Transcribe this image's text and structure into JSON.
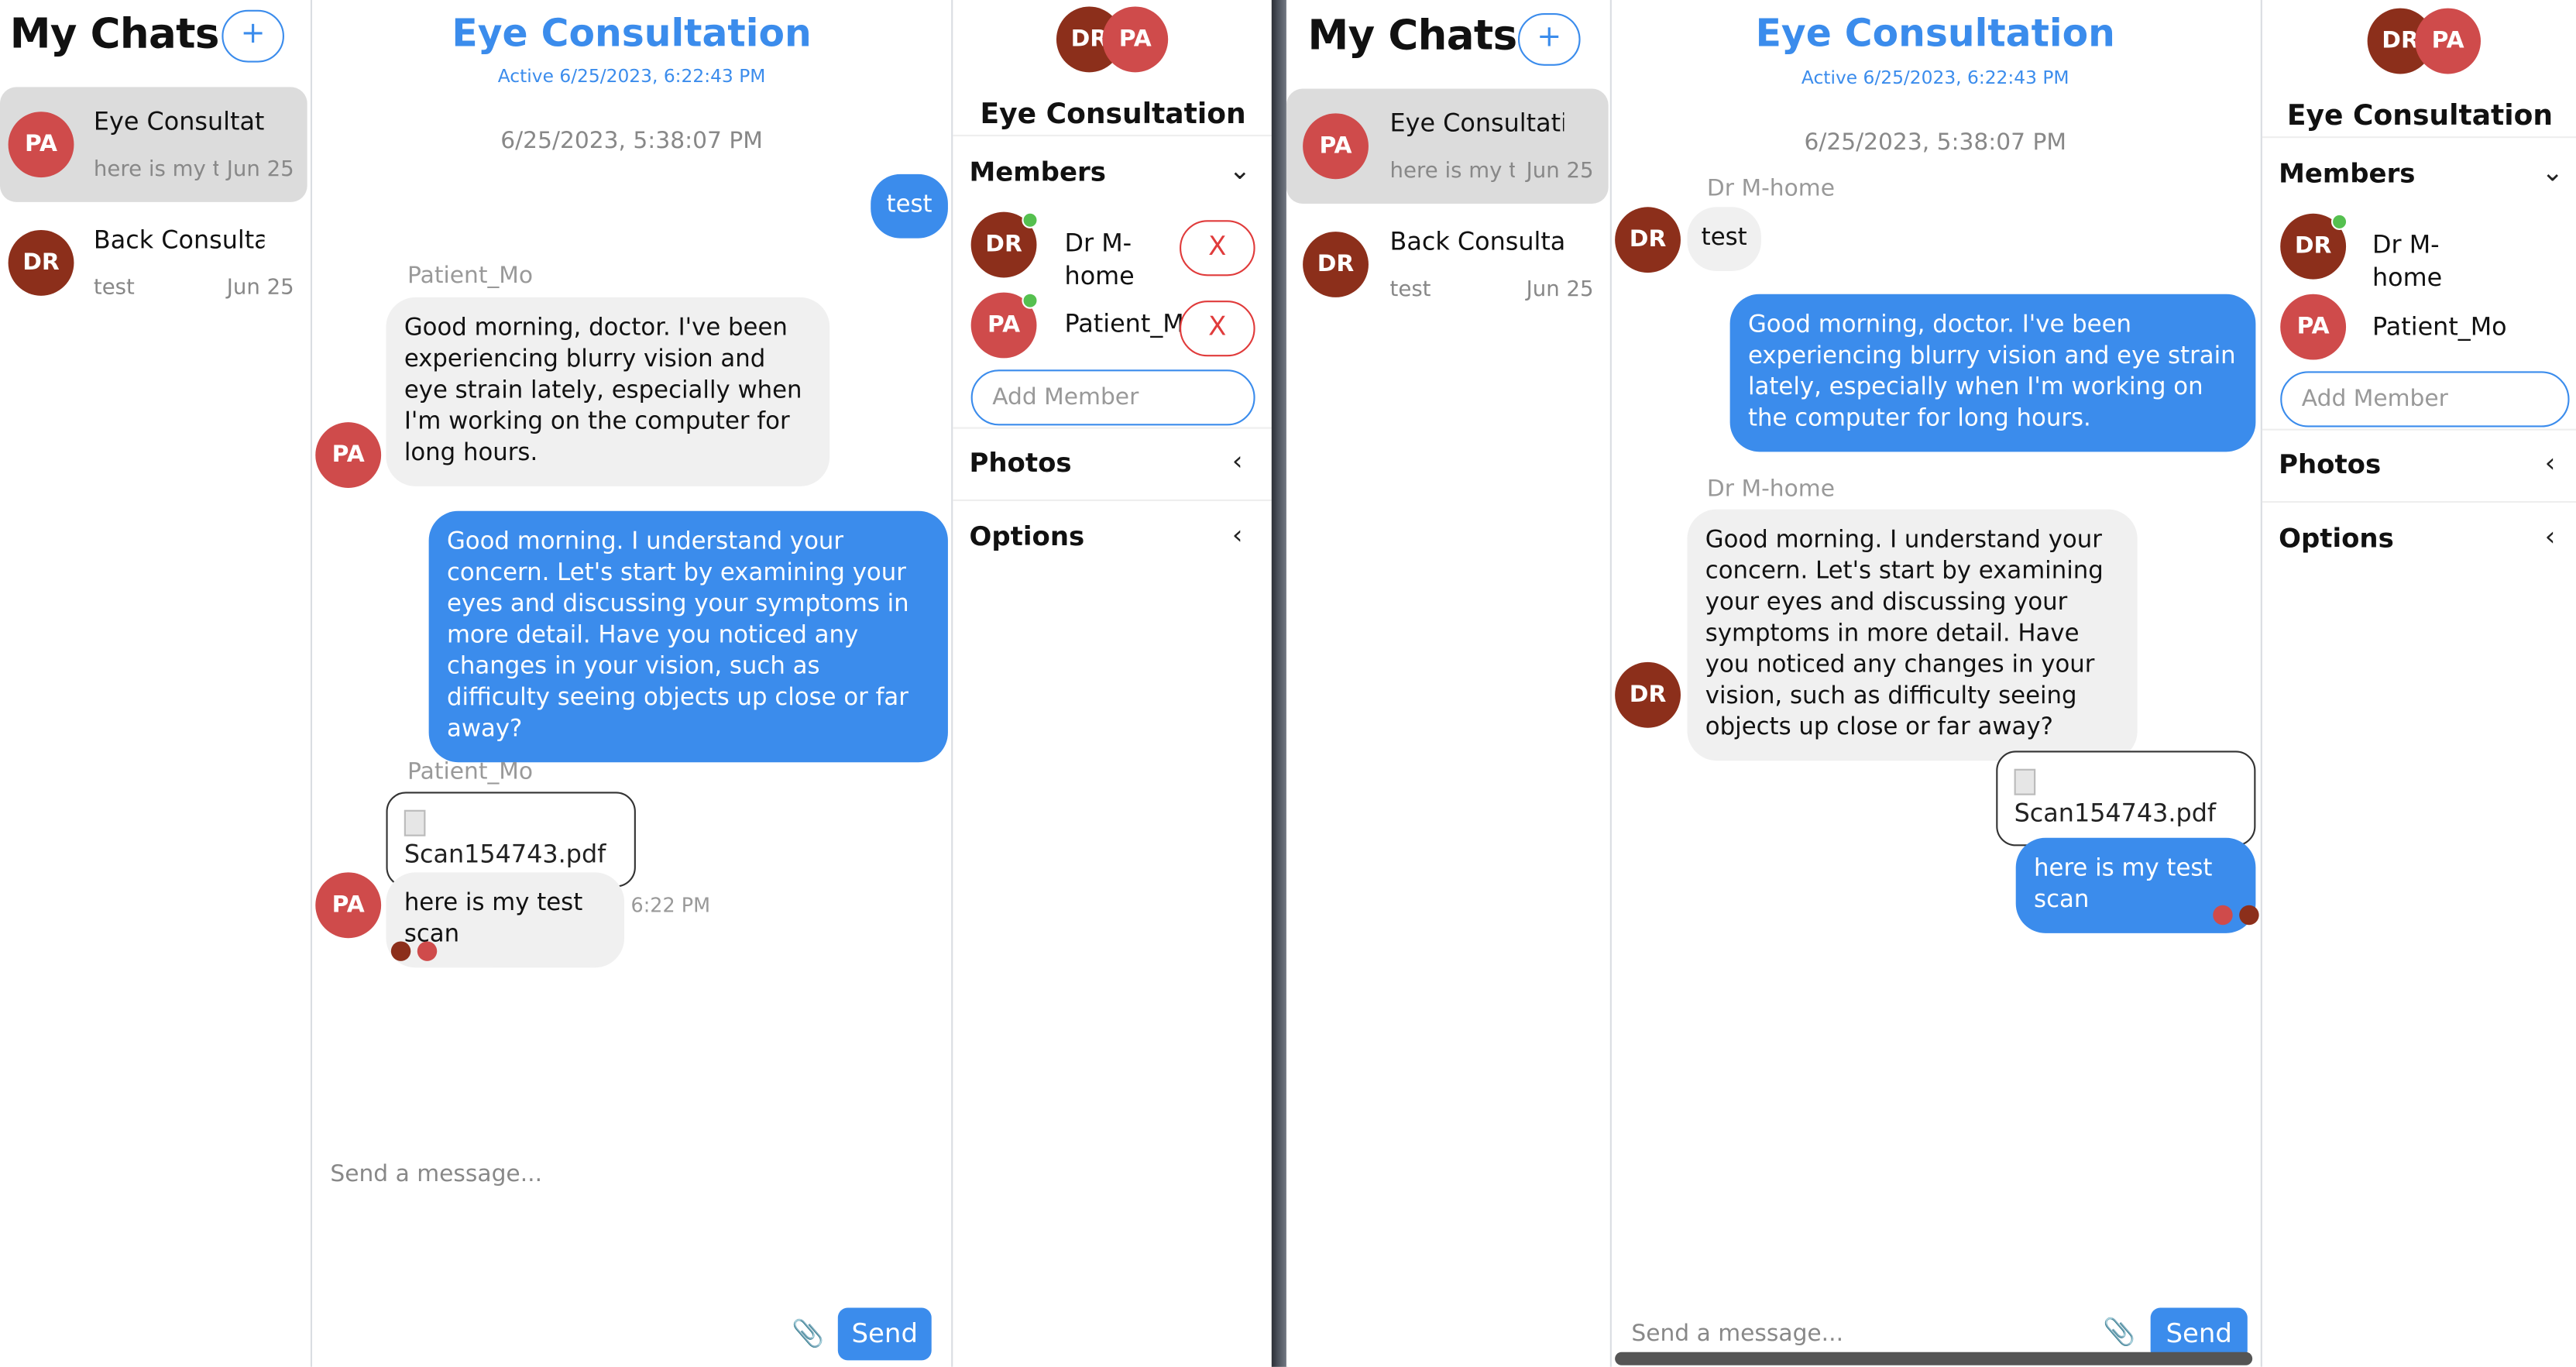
{
  "sidebar": {
    "title": "My Chats",
    "new_chat_glyph": "+",
    "chats": [
      {
        "initials": "PA",
        "title": "Eye Consultati",
        "preview": "here is my te",
        "date": "Jun 25"
      },
      {
        "initials": "DR",
        "title": "Back Consultat",
        "preview": "test",
        "date": "Jun 25"
      }
    ]
  },
  "feed": {
    "title": "Eye Consultation",
    "active_status": "Active 6/25/2023, 6:22:43 PM",
    "timestamp": "6/25/2023, 5:38:07 PM",
    "composer_placeholder": "Send a message...",
    "send_label": "Send",
    "file_name": "Scan154743.pdf",
    "left_view": {
      "messages": [
        {
          "sender": "",
          "text": "test"
        },
        {
          "sender": "Patient_Mo",
          "text": "Good morning, doctor. I've been experiencing blurry vision and eye strain lately, especially when I'm working on the computer for long hours."
        },
        {
          "sender": "",
          "text": "Good morning. I understand your concern. Let's start by examining your eyes and discussing your symptoms in more detail. Have you noticed any changes in your vision, such as difficulty seeing objects up close or far away?"
        },
        {
          "sender": "Patient_Mo",
          "text": "here is my test scan",
          "time": "6:22 PM"
        }
      ]
    },
    "right_view": {
      "messages": [
        {
          "sender": "Dr M-home",
          "text": "test"
        },
        {
          "sender": "",
          "text": "Good morning, doctor. I've been experiencing blurry vision and eye strain lately, especially when I'm working on the computer for long hours."
        },
        {
          "sender": "Dr M-home",
          "text": "Good morning. I understand your concern. Let's start by examining your eyes and discussing your symptoms in more detail. Have you noticed any changes in your vision, such as difficulty seeing objects up close or far away?"
        },
        {
          "sender": "",
          "text": "here is my test scan"
        }
      ]
    }
  },
  "settings": {
    "title": "Eye Consultation",
    "members_label": "Members",
    "photos_label": "Photos",
    "options_label": "Options",
    "add_member_placeholder": "Add Member",
    "remove_glyph": "X",
    "members": [
      {
        "initials": "DR",
        "name": "Dr M-home"
      },
      {
        "initials": "PA",
        "name": "Patient_Mo"
      }
    ],
    "left_member2_truncated": "Patient_M "
  },
  "icons": {
    "expand": "chevron-down-icon",
    "collapse": "chevron-left-icon",
    "attach": "paperclip-icon",
    "file": "document-icon"
  },
  "colors": {
    "accent": "#3b8cec",
    "avatar_patient": "#cf4b4b",
    "avatar_doctor": "#8c2f1b",
    "online": "#55c04f",
    "remove": "#e03b3b"
  }
}
